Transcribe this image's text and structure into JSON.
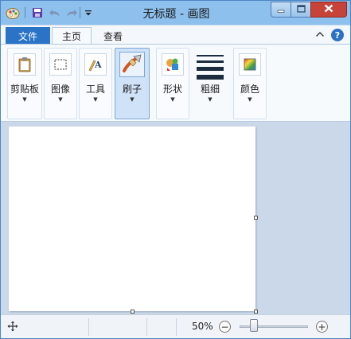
{
  "window": {
    "title": "无标题 - 画图"
  },
  "tabs": {
    "file": "文件",
    "home": "主页",
    "view": "查看"
  },
  "ribbon": {
    "groups": [
      {
        "label": "剪贴板",
        "icon": "clipboard-icon"
      },
      {
        "label": "图像",
        "icon": "select-icon"
      },
      {
        "label": "工具",
        "icon": "tools-icon"
      },
      {
        "label": "刷子",
        "icon": "brush-icon"
      },
      {
        "label": "形状",
        "icon": "shapes-icon"
      },
      {
        "label": "粗细",
        "icon": "line-size-icon"
      },
      {
        "label": "颜色",
        "icon": "colors-icon"
      }
    ],
    "selected_group": "刷子"
  },
  "status": {
    "zoom": "50%",
    "zoom_level": 0.5
  },
  "colors": {
    "title_bar": "#8ec0ee",
    "file_tab": "#2b73c7",
    "close_button": "#c7433a",
    "workarea": "#cbd8e9"
  }
}
